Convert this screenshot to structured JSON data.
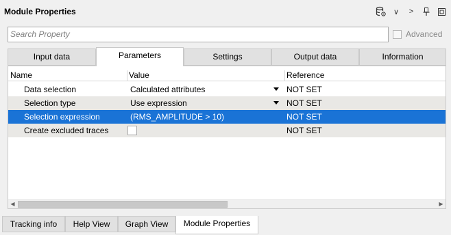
{
  "window": {
    "title": "Module Properties"
  },
  "toolbar": {
    "icons": [
      "database-settings-icon",
      "chevron-down-icon",
      "chevron-right-icon",
      "pin-icon",
      "restore-icon"
    ],
    "chevron_down": "∨",
    "chevron_right": ">"
  },
  "search": {
    "placeholder": "Search Property",
    "value": ""
  },
  "advanced": {
    "label": "Advanced",
    "checked": false,
    "enabled": false
  },
  "tabs": [
    {
      "label": "Input data",
      "active": false
    },
    {
      "label": "Parameters",
      "active": true
    },
    {
      "label": "Settings",
      "active": false
    },
    {
      "label": "Output data",
      "active": false
    },
    {
      "label": "Information",
      "active": false
    }
  ],
  "table": {
    "columns": [
      "Name",
      "Value",
      "Reference"
    ],
    "rows": [
      {
        "name": "Data selection",
        "value": "Calculated attributes",
        "reference": "NOT SET",
        "control": "dropdown"
      },
      {
        "name": "Selection type",
        "value": "Use expression",
        "reference": "NOT SET",
        "control": "dropdown"
      },
      {
        "name": "Selection expression",
        "value": "(RMS_AMPLITUDE > 10)",
        "reference": "NOT SET",
        "control": "text",
        "selected": true
      },
      {
        "name": "Create excluded traces",
        "value": "",
        "reference": "NOT SET",
        "control": "checkbox"
      }
    ]
  },
  "bottom_tabs": [
    {
      "label": "Tracking info",
      "active": false
    },
    {
      "label": "Help View",
      "active": false
    },
    {
      "label": "Graph View",
      "active": false
    },
    {
      "label": "Module Properties",
      "active": true
    }
  ],
  "colors": {
    "selection": "#1a73d6",
    "alt_row": "#e9e8e5",
    "background": "#f0f0f0"
  }
}
